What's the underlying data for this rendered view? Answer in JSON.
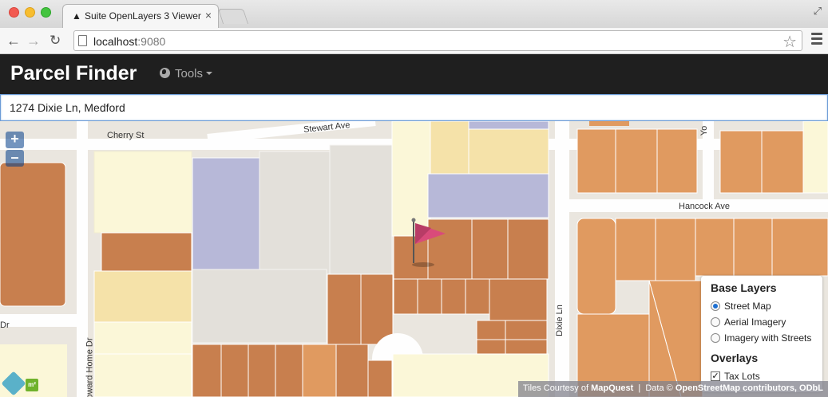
{
  "browser": {
    "tab_title": "Suite OpenLayers 3 Viewer",
    "tab_close": "×",
    "url_host": "localhost",
    "url_port": ":9080"
  },
  "app": {
    "brand": "Parcel Finder",
    "tools_label": "Tools"
  },
  "search": {
    "value": "1274 Dixie Ln, Medford"
  },
  "map": {
    "zoom_in": "+",
    "zoom_out": "–",
    "streets": {
      "cherry": "Cherry St",
      "stewart": "Stewart Ave",
      "hancock": "Hancock Ave",
      "dixie": "Dixie Ln",
      "howard_home": "Howard Home Dr",
      "dr": "Dr",
      "yo": "Yo"
    },
    "colors": {
      "background": "#eae6df",
      "parcel_brown": "#c87f4e",
      "parcel_orange": "#e09a60",
      "parcel_cream": "#fbf7d8",
      "parcel_yellow": "#f5e2a9",
      "parcel_lavender": "#b7b8d8",
      "flag": "#d94b7a"
    }
  },
  "layers": {
    "base_title": "Base Layers",
    "base": [
      {
        "label": "Street Map",
        "selected": true
      },
      {
        "label": "Aerial Imagery",
        "selected": false
      },
      {
        "label": "Imagery with Streets",
        "selected": false
      }
    ],
    "overlays_title": "Overlays",
    "overlays": [
      {
        "label": "Tax Lots",
        "checked": true
      }
    ]
  },
  "attribution": {
    "tiles_prefix": "Tiles Courtesy of",
    "tiles_brand": "MapQuest",
    "data_prefix": "Data ©",
    "data_brand": "OpenStreetMap contributors, ODbL"
  }
}
